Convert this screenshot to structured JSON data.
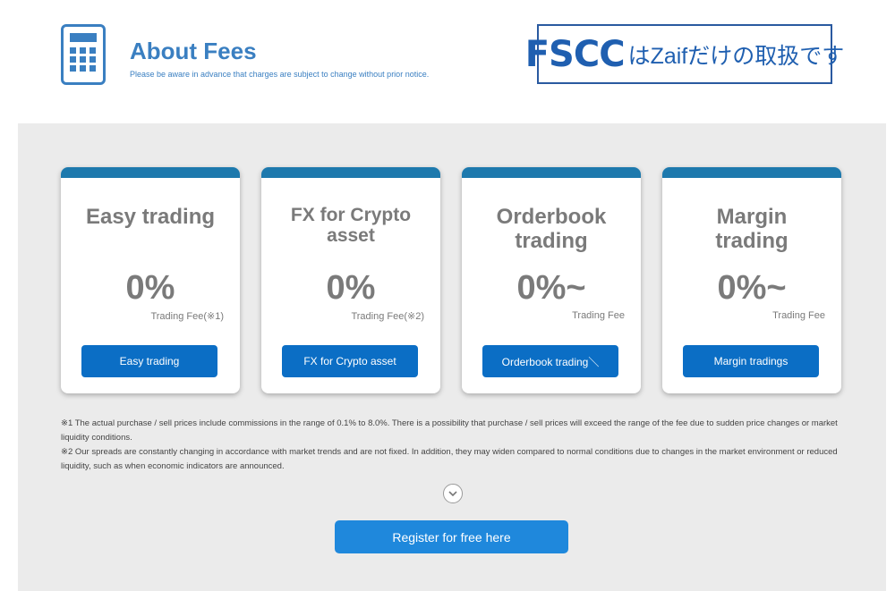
{
  "header": {
    "icon": "calculator-icon",
    "title": "About Fees",
    "subtitle": "Please be aware in advance that charges are subject to change without prior notice."
  },
  "banner": {
    "main": "FSCC",
    "sub": "はZaifだけの取扱です",
    "color": "#1f5fb0"
  },
  "cards": [
    {
      "title": "Easy trading",
      "rate": "0%",
      "fee": "Trading Fee(※1)",
      "button": "Easy trading"
    },
    {
      "title": "FX for Crypto asset",
      "rate": "0%",
      "fee": "Trading Fee(※2)",
      "button": "FX for Crypto asset"
    },
    {
      "title": "Orderbook trading",
      "rate": "0%~",
      "fee": "Trading Fee",
      "button": "Orderbook trading＼"
    },
    {
      "title": "Margin trading",
      "rate": "0%~",
      "fee": "Trading Fee",
      "button": "Margin tradings"
    }
  ],
  "notes": [
    "※1 The actual purchase / sell prices include commissions in the range of 0.1% to 8.0%. There is a possibility that purchase / sell prices will exceed the range of the fee due to sudden price changes or market liquidity conditions.",
    "※2 Our spreads are constantly changing in accordance with market trends and are not fixed. In addition, they may widen compared to normal conditions due to changes in the market environment or reduced liquidity, such as when economic indicators are announced."
  ],
  "expand_icon": "chevron-down-icon",
  "register_button": "Register for free here",
  "colors": {
    "accent": "#3a7fc1",
    "card_bar": "#1d79ad",
    "button": "#0b6ec5",
    "register": "#1f88dc",
    "panel_bg": "#ebebeb"
  }
}
